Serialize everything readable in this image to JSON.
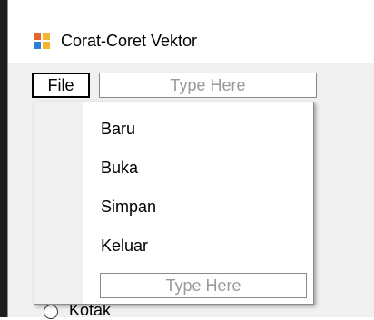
{
  "window": {
    "title": "Corat-Coret Vektor",
    "icon": "app-form-icon"
  },
  "menubar": {
    "file_label": "File",
    "type_here_placeholder": "Type Here"
  },
  "file_menu": {
    "items": [
      {
        "label": "Baru"
      },
      {
        "label": "Buka"
      },
      {
        "label": "Simpan"
      },
      {
        "label": "Keluar"
      }
    ],
    "type_here_placeholder": "Type Here"
  },
  "form": {
    "radio_label": "Kotak"
  },
  "colors": {
    "window_bg": "#f0f0f0",
    "menu_bg": "#ffffff",
    "placeholder_text": "#9a9a9a",
    "border": "#8a8a8a"
  }
}
